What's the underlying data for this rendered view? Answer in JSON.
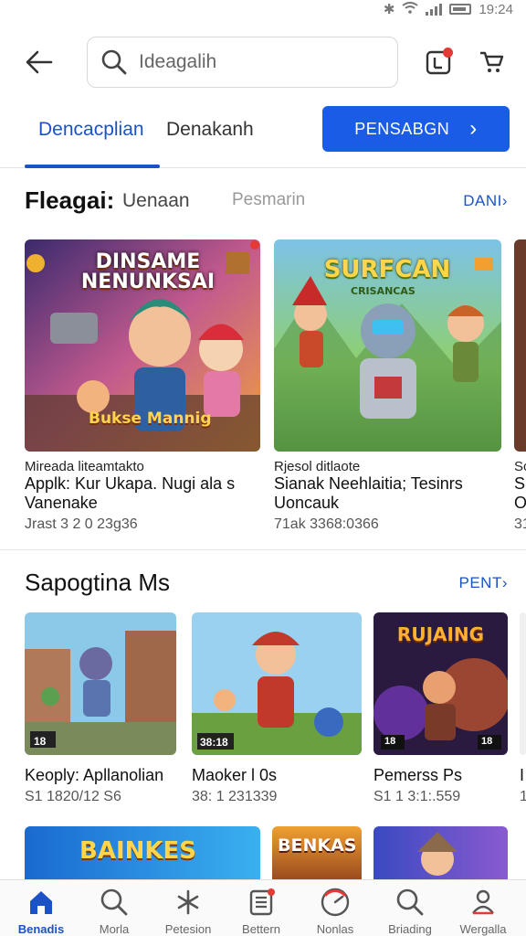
{
  "status": {
    "time": "19:24"
  },
  "search": {
    "value": "Ideagalih"
  },
  "tabs": [
    {
      "label": "Dencacplian"
    },
    {
      "label": "Denakanh"
    }
  ],
  "primary_button": {
    "label": "PENSABGN",
    "chevron": "›"
  },
  "section1": {
    "title": "Fleagai:",
    "subtitle": "Uenaan",
    "filter": "Pesmarin",
    "more": "DANI›",
    "cards": [
      {
        "poster": "DINSAME NENUNKSAI",
        "poster_sub": "Bukse Mannig",
        "title": "Mireada liteamtakto",
        "name_line1": "Applk: Kur Ukapa. Nugi ala s",
        "name_line2": "Vanenake",
        "meta": "Jrast 3 2 0 23g36"
      },
      {
        "poster": "SURFCAN",
        "poster_sub": "CRISANCAS",
        "title": "Rjesol ditlaote",
        "name_line1": "Sianak Neehlaitia; Tesinrs",
        "name_line2": "Uoncauk",
        "meta": "71ak 3368:0366"
      },
      {
        "title": "Sc",
        "name_line1": "SI",
        "name_line2": "O",
        "meta": "31"
      }
    ]
  },
  "section2": {
    "title": "Sapogtina Ms",
    "more": "PENT›",
    "cards": [
      {
        "badge": "18",
        "name": "Keoply: Apllanolian",
        "meta": "S1 1820/12 S6"
      },
      {
        "badge": "38:18",
        "name": "Maoker l 0s",
        "meta": "38: 1 231339"
      },
      {
        "poster": "RUJAING",
        "badge": "18",
        "badge2": "18",
        "name": "Pemerss Ps",
        "meta": "S1 1 3:1:.559"
      },
      {
        "name": "I",
        "meta": "1"
      }
    ]
  },
  "section3": {
    "cards": [
      {
        "poster": "BAINKES"
      },
      {
        "poster": "BENKAS"
      },
      {
        "poster": ""
      }
    ]
  },
  "bottom_nav": [
    {
      "label": "Benadis",
      "icon": "home-icon",
      "active": true
    },
    {
      "label": "Morla",
      "icon": "search-icon"
    },
    {
      "label": "Petesion",
      "icon": "spark-icon"
    },
    {
      "label": "Bettern",
      "icon": "list-icon"
    },
    {
      "label": "Nonlas",
      "icon": "gauge-icon"
    },
    {
      "label": "Briading",
      "icon": "search-icon"
    },
    {
      "label": "Wergalla",
      "icon": "profile-icon"
    }
  ],
  "colors": {
    "accent": "#1b53c6",
    "button": "#1a5ce6",
    "badge": "#e53935"
  }
}
